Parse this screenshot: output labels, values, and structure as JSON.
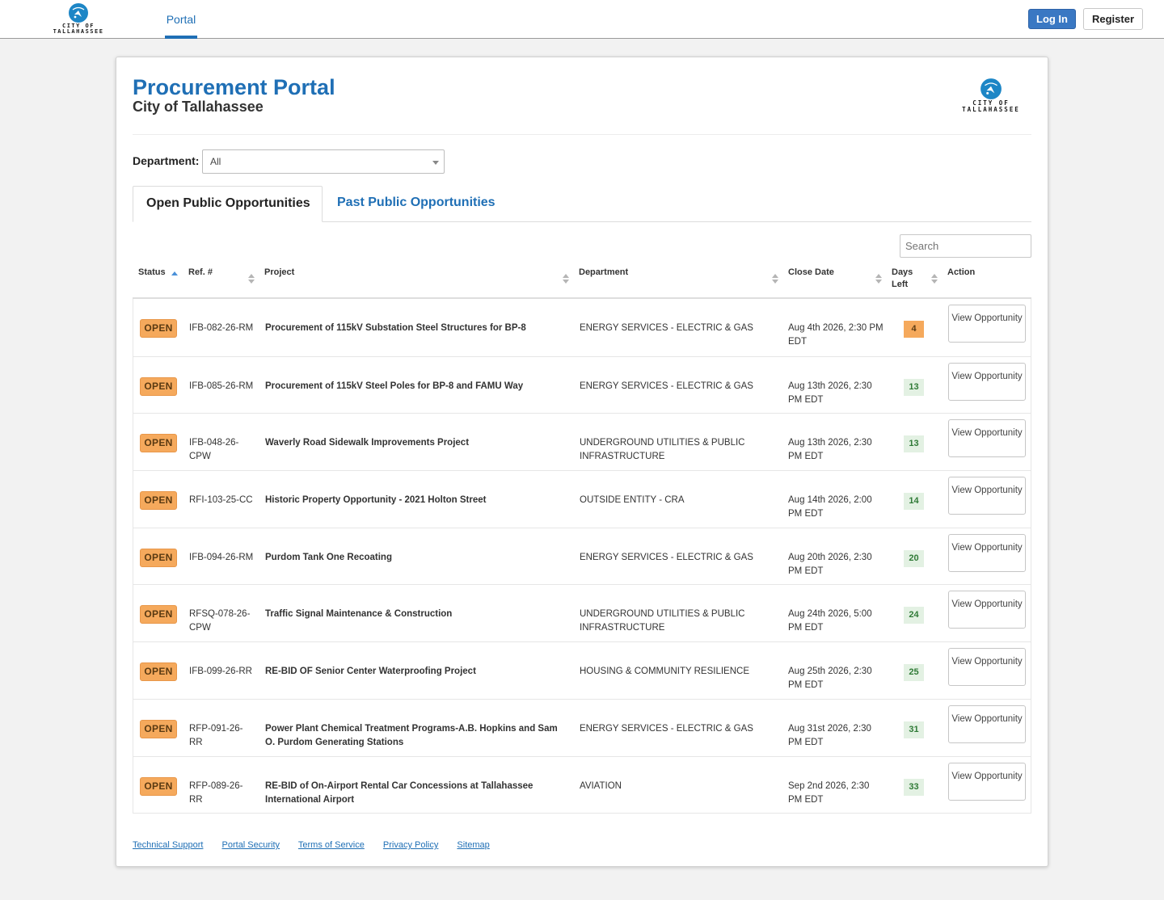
{
  "nav": {
    "logo_text_1": "CITY OF",
    "logo_text_2": "TALLAHASSEE",
    "portal_label": "Portal",
    "login_label": "Log In",
    "register_label": "Register"
  },
  "header": {
    "title": "Procurement Portal",
    "subtitle": "City of Tallahassee",
    "logo_text_1": "CITY OF",
    "logo_text_2": "TALLAHASSEE"
  },
  "filter": {
    "label": "Department:",
    "selected": "All"
  },
  "tabs": {
    "open": "Open Public Opportunities",
    "past": "Past Public Opportunities"
  },
  "search": {
    "placeholder": "Search"
  },
  "columns": {
    "status": "Status",
    "ref": "Ref. #",
    "project": "Project",
    "department": "Department",
    "close_date": "Close Date",
    "days_left": "Days Left",
    "action": "Action"
  },
  "rows": [
    {
      "status": "OPEN",
      "ref": "IFB-082-26-RM",
      "project": "Procurement of 115kV Substation Steel Structures for BP-8",
      "department": "ENERGY SERVICES - ELECTRIC & GAS",
      "close_date": "Aug 4th 2026, 2:30 PM EDT",
      "days_left": "4",
      "action": "View Opportunity"
    },
    {
      "status": "OPEN",
      "ref": "IFB-085-26-RM",
      "project": "Procurement of 115kV Steel Poles for BP-8 and FAMU Way",
      "department": "ENERGY SERVICES - ELECTRIC & GAS",
      "close_date": "Aug 13th 2026, 2:30 PM EDT",
      "days_left": "13",
      "action": "View Opportunity"
    },
    {
      "status": "OPEN",
      "ref": "IFB-048-26-CPW",
      "project": "Waverly Road Sidewalk Improvements Project",
      "department": "UNDERGROUND UTILITIES & PUBLIC INFRASTRUCTURE",
      "close_date": "Aug 13th 2026, 2:30 PM EDT",
      "days_left": "13",
      "action": "View Opportunity"
    },
    {
      "status": "OPEN",
      "ref": "RFI-103-25-CC",
      "project": "Historic Property Opportunity - 2021 Holton Street",
      "department": "OUTSIDE ENTITY - CRA",
      "close_date": "Aug 14th 2026, 2:00 PM EDT",
      "days_left": "14",
      "action": "View Opportunity"
    },
    {
      "status": "OPEN",
      "ref": "IFB-094-26-RM",
      "project": "Purdom Tank One Recoating",
      "department": "ENERGY SERVICES - ELECTRIC & GAS",
      "close_date": "Aug 20th 2026, 2:30 PM EDT",
      "days_left": "20",
      "action": "View Opportunity"
    },
    {
      "status": "OPEN",
      "ref": "RFSQ-078-26-CPW",
      "project": "Traffic Signal Maintenance & Construction",
      "department": "UNDERGROUND UTILITIES & PUBLIC INFRASTRUCTURE",
      "close_date": "Aug 24th 2026, 5:00 PM EDT",
      "days_left": "24",
      "action": "View Opportunity"
    },
    {
      "status": "OPEN",
      "ref": "IFB-099-26-RR",
      "project": "RE-BID OF Senior Center Waterproofing Project",
      "department": "HOUSING & COMMUNITY RESILIENCE",
      "close_date": "Aug 25th 2026, 2:30 PM EDT",
      "days_left": "25",
      "action": "View Opportunity"
    },
    {
      "status": "OPEN",
      "ref": "RFP-091-26-RR",
      "project": "Power Plant Chemical Treatment Programs-A.B. Hopkins and Sam O. Purdom Generating Stations",
      "department": "ENERGY SERVICES - ELECTRIC & GAS",
      "close_date": "Aug 31st 2026, 2:30 PM EDT",
      "days_left": "31",
      "action": "View Opportunity"
    },
    {
      "status": "OPEN",
      "ref": "RFP-089-26-RR",
      "project": "RE-BID of On-Airport Rental Car Concessions at Tallahassee International Airport",
      "department": "AVIATION",
      "close_date": "Sep 2nd 2026, 2:30 PM EDT",
      "days_left": "33",
      "action": "View Opportunity"
    }
  ],
  "footer": {
    "links": [
      "Technical Support",
      "Portal Security",
      "Terms of Service",
      "Privacy Policy",
      "Sitemap"
    ]
  },
  "colors": {
    "accent": "#1f6fb5",
    "open_badge": "#f5a95c",
    "days_badge_green": "#e3f1e3"
  }
}
